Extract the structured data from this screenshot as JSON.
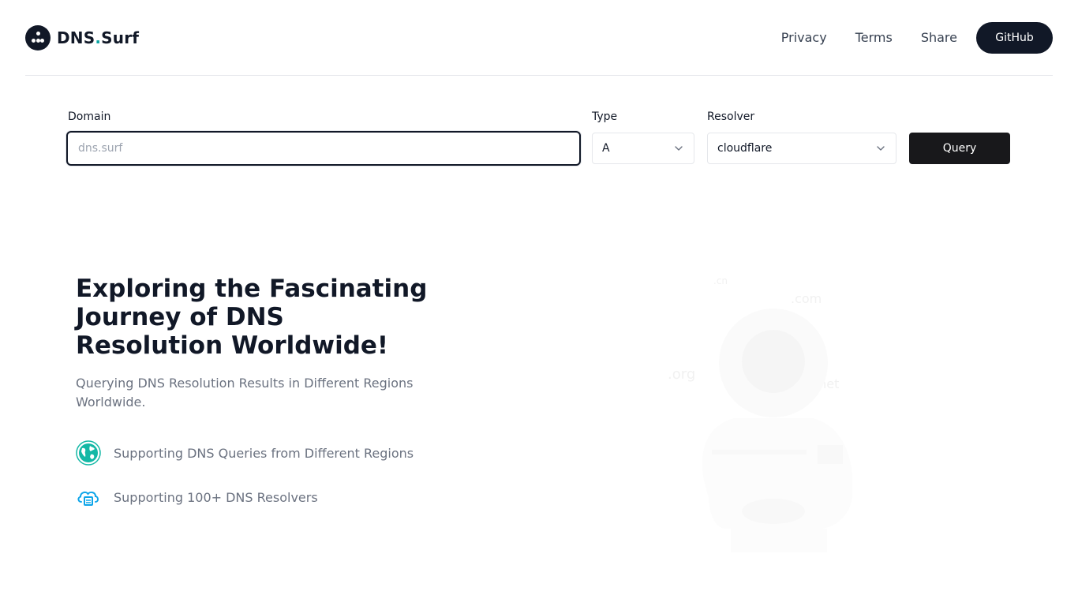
{
  "header": {
    "brand_name": "DNS",
    "brand_dot": ".",
    "brand_suffix": "Surf",
    "nav": [
      {
        "label": "Privacy"
      },
      {
        "label": "Terms"
      },
      {
        "label": "Share"
      }
    ],
    "github_label": "GitHub"
  },
  "form": {
    "domain_label": "Domain",
    "domain_placeholder": "dns.surf",
    "domain_value": "",
    "type_label": "Type",
    "type_value": "A",
    "resolver_label": "Resolver",
    "resolver_value": "cloudflare",
    "query_label": "Query"
  },
  "hero": {
    "title": "Exploring the Fascinating Journey of DNS Resolution Worldwide!",
    "subtitle": "Querying DNS Resolution Results in Different Regions Worldwide.",
    "features": [
      {
        "icon": "globe-icon",
        "text": "Supporting DNS Queries from Different Regions"
      },
      {
        "icon": "cloud-server-icon",
        "text": "Supporting 100+ DNS Resolvers"
      }
    ]
  },
  "illustration": {
    "tlds": [
      ".cn",
      ".com",
      ".org",
      ".net"
    ]
  },
  "colors": {
    "primary": "#111827",
    "accent": "#0ea5a4",
    "muted": "#6b7280",
    "border": "#e5e7eb"
  }
}
